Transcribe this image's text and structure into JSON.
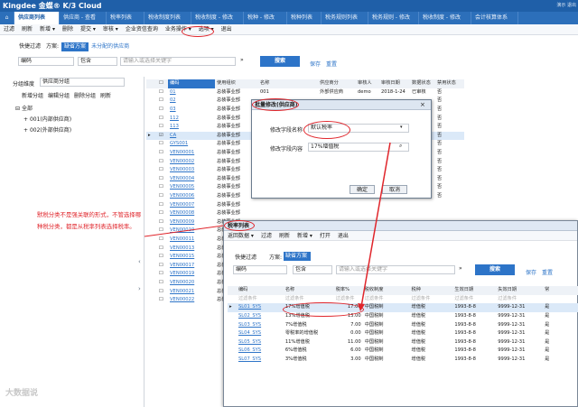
{
  "app": {
    "logo": "Kingdee 金蝶® K/3 Cloud",
    "top_right": "演示 退出"
  },
  "tabs": [
    {
      "label": "⌂"
    },
    {
      "label": "供应商列表"
    },
    {
      "label": "供应商 - 查看"
    },
    {
      "label": "税率列表"
    },
    {
      "label": "税收制度列表"
    },
    {
      "label": "税收制度 - 修改"
    },
    {
      "label": "税种 - 修改"
    },
    {
      "label": "税种列表"
    },
    {
      "label": "税务规则列表"
    },
    {
      "label": "税务规则 - 修改"
    },
    {
      "label": "税收制度 - 修改"
    },
    {
      "label": "会计核算体系"
    }
  ],
  "toolbar": [
    "过滤",
    "刷新",
    "新增 ▾",
    "删除",
    "提交 ▾",
    "审核 ▾",
    "企业资信查询",
    "业务操作 ▾",
    "选项 ▾",
    "退出"
  ],
  "filter": {
    "quick": "快捷过滤",
    "scheme": "方案:",
    "default_scheme": "缺省方案",
    "unassigned": "未分配的供应商",
    "field": "编码",
    "op": "包含",
    "placeholder": "请输入或选择关键字",
    "search": "搜索",
    "save": "保存",
    "reset": "重置"
  },
  "left": {
    "group_label": "分组维度",
    "group_value": "供应商分组",
    "buttons": [
      "新增分组",
      "编辑分组",
      "删除分组",
      "刷新"
    ],
    "tree": [
      "全部",
      "001(内部供应商)",
      "002(外部供应商)"
    ]
  },
  "main_table": {
    "headers": [
      "编码",
      "使用组织",
      "名称",
      "供应商分",
      "审核人",
      "审核日期",
      "数据状态",
      "禁用状态"
    ],
    "rows": [
      {
        "code": "01",
        "org": "总装事业部",
        "name": "001",
        "cls": "外部供应商",
        "auditor": "demo",
        "date": "2018-1-24",
        "status": "已审核",
        "dis": "否"
      },
      {
        "code": "02",
        "org": "总装事业部",
        "name": "",
        "cls": "",
        "auditor": "",
        "date": "",
        "status": "",
        "dis": "否"
      },
      {
        "code": "03",
        "org": "总装事业部",
        "name": "",
        "cls": "",
        "auditor": "",
        "date": "",
        "status": "",
        "dis": "否"
      },
      {
        "code": "112",
        "org": "总装事业部",
        "name": "",
        "cls": "",
        "auditor": "",
        "date": "",
        "status": "",
        "dis": "否"
      },
      {
        "code": "113",
        "org": "总装事业部",
        "name": "",
        "cls": "",
        "auditor": "",
        "date": "",
        "status": "",
        "dis": "否"
      },
      {
        "code": "CA",
        "org": "总装事业部",
        "name": "",
        "cls": "",
        "auditor": "",
        "date": "",
        "status": "",
        "dis": "否"
      },
      {
        "code": "GYS001",
        "org": "总装事业部",
        "name": "",
        "cls": "",
        "auditor": "",
        "date": "",
        "status": "",
        "dis": "否"
      },
      {
        "code": "VEN00001",
        "org": "总装事业部",
        "name": "",
        "cls": "",
        "auditor": "",
        "date": "",
        "status": "",
        "dis": "否"
      },
      {
        "code": "VEN00002",
        "org": "总装事业部",
        "name": "",
        "cls": "",
        "auditor": "",
        "date": "",
        "status": "",
        "dis": "否"
      },
      {
        "code": "VEN00003",
        "org": "总装事业部",
        "name": "",
        "cls": "",
        "auditor": "",
        "date": "",
        "status": "",
        "dis": "否"
      },
      {
        "code": "VEN00004",
        "org": "总装事业部",
        "name": "",
        "cls": "",
        "auditor": "",
        "date": "",
        "status": "",
        "dis": "否"
      },
      {
        "code": "VEN00005",
        "org": "总装事业部",
        "name": "蓝海新材料",
        "cls": "内部供应商",
        "auditor": "demo",
        "date": "2014-8-21",
        "status": "已审核",
        "dis": "否"
      },
      {
        "code": "VEN00006",
        "org": "总装事业部",
        "name": "蓝海机械北京",
        "cls": "内部供应商",
        "auditor": "demo",
        "date": "2014-8-21",
        "status": "已审核",
        "dis": "否"
      },
      {
        "code": "VEN00007",
        "org": "总装事业部",
        "name": "",
        "cls": "",
        "auditor": "",
        "date": "",
        "status": "",
        "dis": ""
      },
      {
        "code": "VEN00008",
        "org": "总装事业部",
        "name": "",
        "cls": "",
        "auditor": "",
        "date": "",
        "status": "",
        "dis": ""
      },
      {
        "code": "VEN00009",
        "org": "总装事业部",
        "name": "",
        "cls": "",
        "auditor": "",
        "date": "",
        "status": "",
        "dis": ""
      },
      {
        "code": "VEN00010",
        "org": "总装事业部",
        "name": "",
        "cls": "",
        "auditor": "",
        "date": "",
        "status": "",
        "dis": ""
      },
      {
        "code": "VEN00011",
        "org": "总装事业部",
        "name": "",
        "cls": "",
        "auditor": "",
        "date": "",
        "status": "",
        "dis": ""
      },
      {
        "code": "VEN00013",
        "org": "总装事业部",
        "name": "",
        "cls": "",
        "auditor": "",
        "date": "",
        "status": "",
        "dis": ""
      },
      {
        "code": "VEN00015",
        "org": "总装事业部",
        "name": "",
        "cls": "",
        "auditor": "",
        "date": "",
        "status": "",
        "dis": ""
      },
      {
        "code": "VEN00017",
        "org": "总装事业部",
        "name": "",
        "cls": "",
        "auditor": "",
        "date": "",
        "status": "",
        "dis": ""
      },
      {
        "code": "VEN00019",
        "org": "总装事业部",
        "name": "",
        "cls": "",
        "auditor": "",
        "date": "",
        "status": "",
        "dis": ""
      },
      {
        "code": "VEN00020",
        "org": "总装事业部",
        "name": "",
        "cls": "",
        "auditor": "",
        "date": "",
        "status": "",
        "dis": ""
      },
      {
        "code": "VEN00021",
        "org": "总装事业部",
        "name": "",
        "cls": "",
        "auditor": "",
        "date": "",
        "status": "",
        "dis": ""
      },
      {
        "code": "VEN00022",
        "org": "总装事业部",
        "name": "",
        "cls": "",
        "auditor": "",
        "date": "",
        "status": "",
        "dis": ""
      }
    ]
  },
  "dialog": {
    "title": "批量修改(供应商)",
    "field_label": "修改字段名称",
    "field_value": "默认税率",
    "content_label": "修改字段内容",
    "content_value": "17%增值税",
    "ok": "确定",
    "cancel": "取消"
  },
  "sub": {
    "title": "税率列表",
    "toolbar": [
      "返回数据 ▾",
      "过滤",
      "刷新",
      "新增 ▾",
      "打开",
      "退出"
    ],
    "quick": "快捷过滤",
    "scheme": "方案:",
    "default_scheme": "缺省方案",
    "field": "编码",
    "op": "包含",
    "placeholder": "请输入或选择关键字",
    "search": "搜索",
    "save": "保存",
    "reset": "重置",
    "headers": [
      "编码",
      "名称",
      "税率%",
      "税收制度",
      "税种",
      "生效日期",
      "失效日期",
      "常"
    ],
    "filter_row": [
      "过滤条件",
      "过滤条件",
      "过滤条件",
      "过滤条件",
      "过滤条件",
      "过滤条件",
      "过滤条件"
    ],
    "rows": [
      {
        "code": "SL01_SYS",
        "name": "17%增值税",
        "rate": "17.00",
        "sys": "中国税制",
        "kind": "增值税",
        "eff": "1993-8-8",
        "exp": "9999-12-31",
        "c": "是"
      },
      {
        "code": "SL02_SYS",
        "name": "13%增值税",
        "rate": "13.00",
        "sys": "中国税制",
        "kind": "增值税",
        "eff": "1993-8-8",
        "exp": "9999-12-31",
        "c": "是"
      },
      {
        "code": "SL03_SYS",
        "name": "7%增值税",
        "rate": "7.00",
        "sys": "中国税制",
        "kind": "增值税",
        "eff": "1993-8-8",
        "exp": "9999-12-31",
        "c": "是"
      },
      {
        "code": "SL04_SYS",
        "name": "零税率的增值税",
        "rate": "0.00",
        "sys": "中国税制",
        "kind": "增值税",
        "eff": "1993-8-8",
        "exp": "9999-12-31",
        "c": "是"
      },
      {
        "code": "SL05_SYS",
        "name": "11%增值税",
        "rate": "11.00",
        "sys": "中国税制",
        "kind": "增值税",
        "eff": "1993-8-8",
        "exp": "9999-12-31",
        "c": "是"
      },
      {
        "code": "SL06_SYS",
        "name": "6%增值税",
        "rate": "6.00",
        "sys": "中国税制",
        "kind": "增值税",
        "eff": "1993-8-8",
        "exp": "9999-12-31",
        "c": "是"
      },
      {
        "code": "SL07_SYS",
        "name": "3%增值税",
        "rate": "3.00",
        "sys": "中国税制",
        "kind": "增值税",
        "eff": "1993-8-8",
        "exp": "9999-12-31",
        "c": "是"
      }
    ]
  },
  "annotation": "默税分类不是强关联的形式，不管选择哪种税分类，都是从税率列表选择税率。",
  "watermark": "大数据说",
  "colors": {
    "header_blue": "#1f5fa8",
    "accent": "#2d74c8",
    "annotation_red": "#e0252b"
  }
}
